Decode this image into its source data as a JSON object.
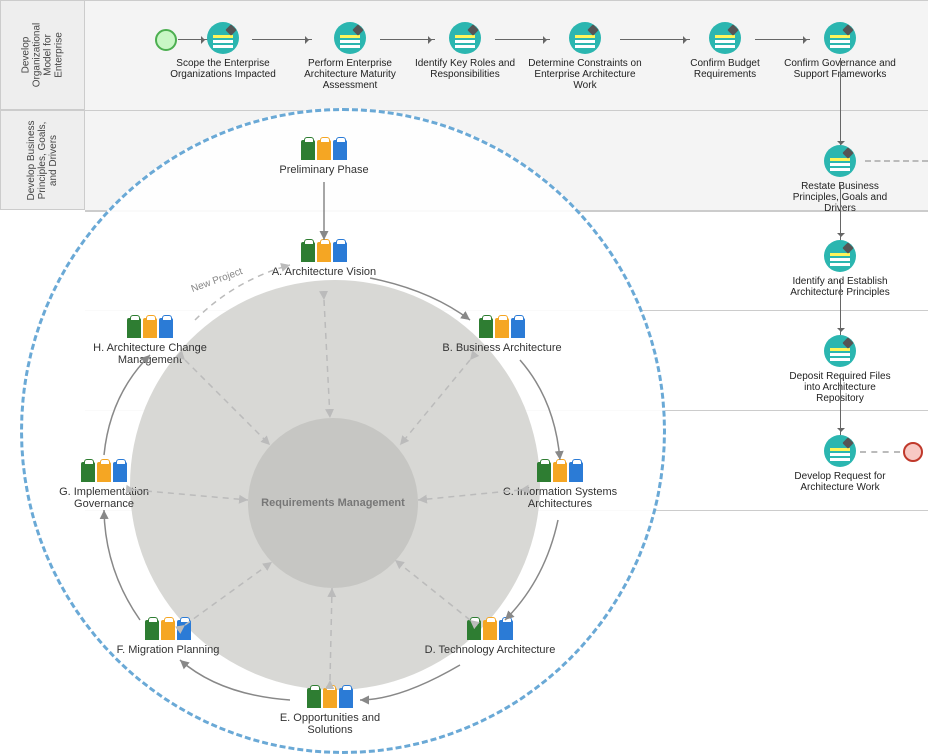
{
  "diagram_type": "TOGAF ADM process + swimlane workflow",
  "lanes": {
    "lane1": "Develop\nOrganizational\nModel for\nEnterprise",
    "lane2": "Develop Business\nPrinciples, Goals,\nand Drivers"
  },
  "process": {
    "n1": "Scope the Enterprise Organizations Impacted",
    "n2": "Perform Enterprise Architecture Maturity Assessment",
    "n3": "Identify Key Roles and Responsibilities",
    "n4": "Determine Constraints on Enterprise Architecture Work",
    "n5": "Confirm Budget Requirements",
    "n6": "Confirm Governance and Support Frameworks",
    "n7": "Restate Business Principles, Goals and Drivers",
    "n8": "Identify and Establish Architecture Principles",
    "n9": "Deposit Required Files into Architecture Repository",
    "n10": "Develop Request for Architecture Work"
  },
  "wheel": {
    "center": "Requirements Management",
    "top": "Preliminary Phase",
    "A": "A. Architecture Vision",
    "B": "B. Business Architecture",
    "C": "C. Information Systems Architectures",
    "D": "D. Technology Architecture",
    "E": "E. Opportunities and Solutions",
    "F": "F. Migration Planning",
    "G": "G. Implementation Governance",
    "H": "H. Architecture Change Management",
    "note": "New Project"
  },
  "flow": [
    "start",
    "n1",
    "n2",
    "n3",
    "n4",
    "n5",
    "n6",
    "n7",
    "n8",
    "n9",
    "n10",
    "end"
  ]
}
